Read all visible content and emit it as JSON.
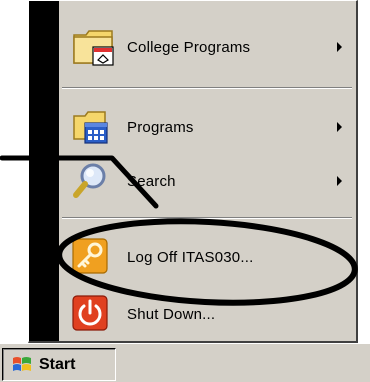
{
  "start_menu": {
    "items": [
      {
        "label": "College Programs",
        "icon": "folder-shortcut-icon",
        "has_submenu": true
      },
      {
        "label": "Programs",
        "icon": "programs-folder-icon",
        "has_submenu": true
      },
      {
        "label": "Search",
        "icon": "search-icon",
        "has_submenu": true
      },
      {
        "label": "Log Off ITAS030...",
        "icon": "key-icon",
        "has_submenu": false
      },
      {
        "label": "Shut Down...",
        "icon": "power-icon",
        "has_submenu": false
      }
    ]
  },
  "taskbar": {
    "start_label": "Start",
    "start_icon": "windows-logo-icon"
  },
  "annotation": {
    "type": "ellipse-highlight-with-pointer-line",
    "target": "Log Off ITAS030...",
    "color": "#000000"
  }
}
